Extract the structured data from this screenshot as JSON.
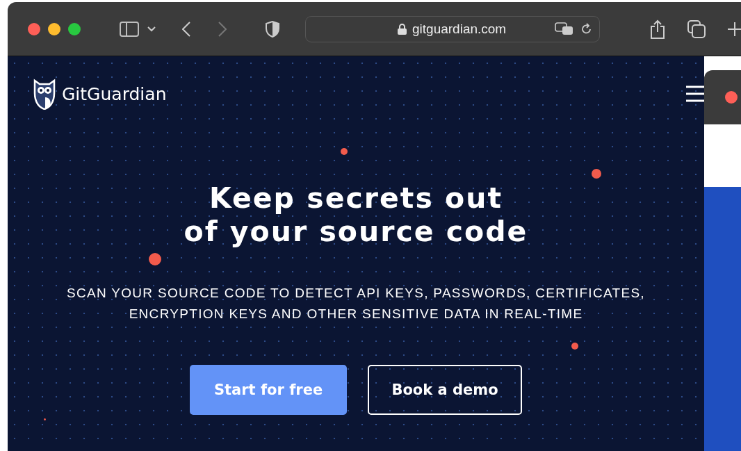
{
  "browser": {
    "url": "gitguardian.com"
  },
  "site": {
    "logo_text": "GitGuardian"
  },
  "hero": {
    "title_lines": [
      "Keep secrets out",
      "of your source code"
    ],
    "subtitle_lines": [
      "SCAN YOUR SOURCE CODE TO DETECT API KEYS, PASSWORDS, CERTIFICATES,",
      "ENCRYPTION KEYS AND OTHER SENSITIVE DATA IN REAL-TIME"
    ],
    "buttons": [
      {
        "label": "Start for free",
        "kind": "primary"
      },
      {
        "label": "Book a demo",
        "kind": "outline"
      }
    ]
  }
}
